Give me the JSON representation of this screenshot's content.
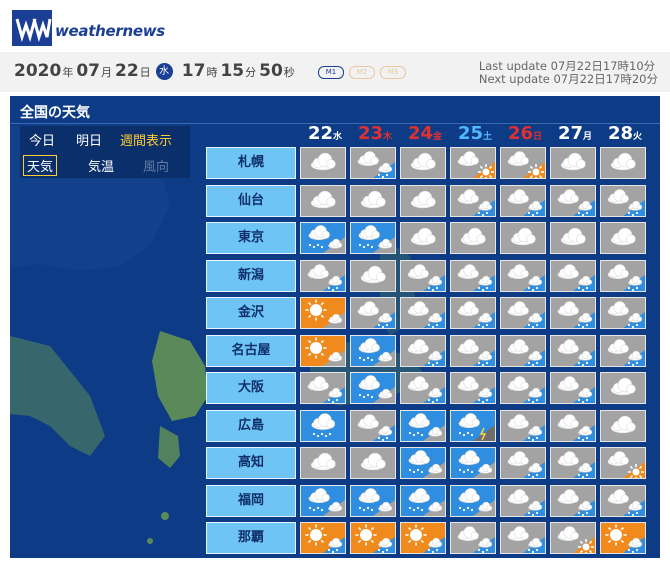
{
  "header": {
    "logo_text": "weathernews"
  },
  "date": {
    "year": "2020",
    "month": "07",
    "day": "22",
    "weekday": "水",
    "hour": "17",
    "minute": "15",
    "second": "50",
    "u_year": "年",
    "u_month": "月",
    "u_day": "日",
    "u_hour": "時",
    "u_minute": "分",
    "u_second": "秒"
  },
  "modes": [
    "M1",
    "M2",
    "M3"
  ],
  "update": {
    "last": "Last update  07月22日17時10分",
    "next": "Next update  07月22日17時20分"
  },
  "panel": {
    "title": "全国の天気",
    "tabs": {
      "today": "今日",
      "tomorrow": "明日",
      "weekly": "週間表示",
      "weather": "天気",
      "temperature": "気温",
      "wind": "風向"
    }
  },
  "days": [
    {
      "d": "22",
      "w": "水",
      "color": "#ffffff"
    },
    {
      "d": "23",
      "w": "木",
      "color": "#e03030"
    },
    {
      "d": "24",
      "w": "金",
      "color": "#e03030"
    },
    {
      "d": "25",
      "w": "土",
      "color": "#4fb8ff"
    },
    {
      "d": "26",
      "w": "日",
      "color": "#e03030"
    },
    {
      "d": "27",
      "w": "月",
      "color": "#ffffff"
    },
    {
      "d": "28",
      "w": "火",
      "color": "#ffffff"
    }
  ],
  "cities": [
    {
      "name": "札幌",
      "forecast": [
        "cloudy",
        "cloudy-rain",
        "cloudy",
        "cloudy-sun",
        "cloudy-sun",
        "cloudy",
        "cloudy"
      ]
    },
    {
      "name": "仙台",
      "forecast": [
        "cloudy",
        "cloudy",
        "cloudy",
        "cloudy-rain",
        "cloudy-rain",
        "cloudy-rain",
        "cloudy-rain"
      ]
    },
    {
      "name": "東京",
      "forecast": [
        "rain-cloud",
        "rain-cloud",
        "cloudy",
        "cloudy",
        "cloudy",
        "cloudy",
        "cloudy"
      ]
    },
    {
      "name": "新潟",
      "forecast": [
        "cloudy-rain",
        "cloudy",
        "cloudy-rain",
        "cloudy-rain",
        "cloudy-rain",
        "cloudy-rain",
        "cloudy-rain"
      ]
    },
    {
      "name": "金沢",
      "forecast": [
        "sun-cloud",
        "cloudy-rain",
        "cloudy-rain",
        "cloudy-rain",
        "cloudy-rain",
        "cloudy-rain",
        "cloudy-rain"
      ]
    },
    {
      "name": "名古屋",
      "forecast": [
        "sun-cloud",
        "rain-cloud",
        "cloudy-rain",
        "cloudy-rain",
        "cloudy-rain",
        "cloudy-rain",
        "cloudy-rain"
      ]
    },
    {
      "name": "大阪",
      "forecast": [
        "cloudy-rain",
        "rain-cloud",
        "cloudy-rain",
        "cloudy-rain",
        "cloudy-rain",
        "cloudy-rain",
        "cloudy"
      ]
    },
    {
      "name": "広島",
      "forecast": [
        "rain",
        "cloudy-rain",
        "rain-cloud",
        "storm",
        "cloudy-rain",
        "cloudy-rain",
        "cloudy"
      ]
    },
    {
      "name": "高知",
      "forecast": [
        "cloudy",
        "cloudy",
        "rain-cloud",
        "rain-cloud",
        "cloudy-rain",
        "cloudy-rain",
        "cloudy-sun"
      ]
    },
    {
      "name": "福岡",
      "forecast": [
        "rain-cloud",
        "rain-cloud",
        "rain-cloud",
        "rain-cloud",
        "cloudy-rain",
        "cloudy-rain",
        "cloudy-rain"
      ]
    },
    {
      "name": "那覇",
      "forecast": [
        "sun-rain",
        "sun-rain",
        "sun-rain",
        "cloudy-rain",
        "cloudy-rain",
        "cloudy-sun",
        "sun-rain"
      ]
    }
  ],
  "colors": {
    "cloudy": "#a3a3a3",
    "rainy": "#2f8ee0",
    "sunny": "#f08a1c",
    "map_bg": "#0e3b86",
    "land": "#5a8a5a",
    "city_btn": "#6ec4f5"
  }
}
